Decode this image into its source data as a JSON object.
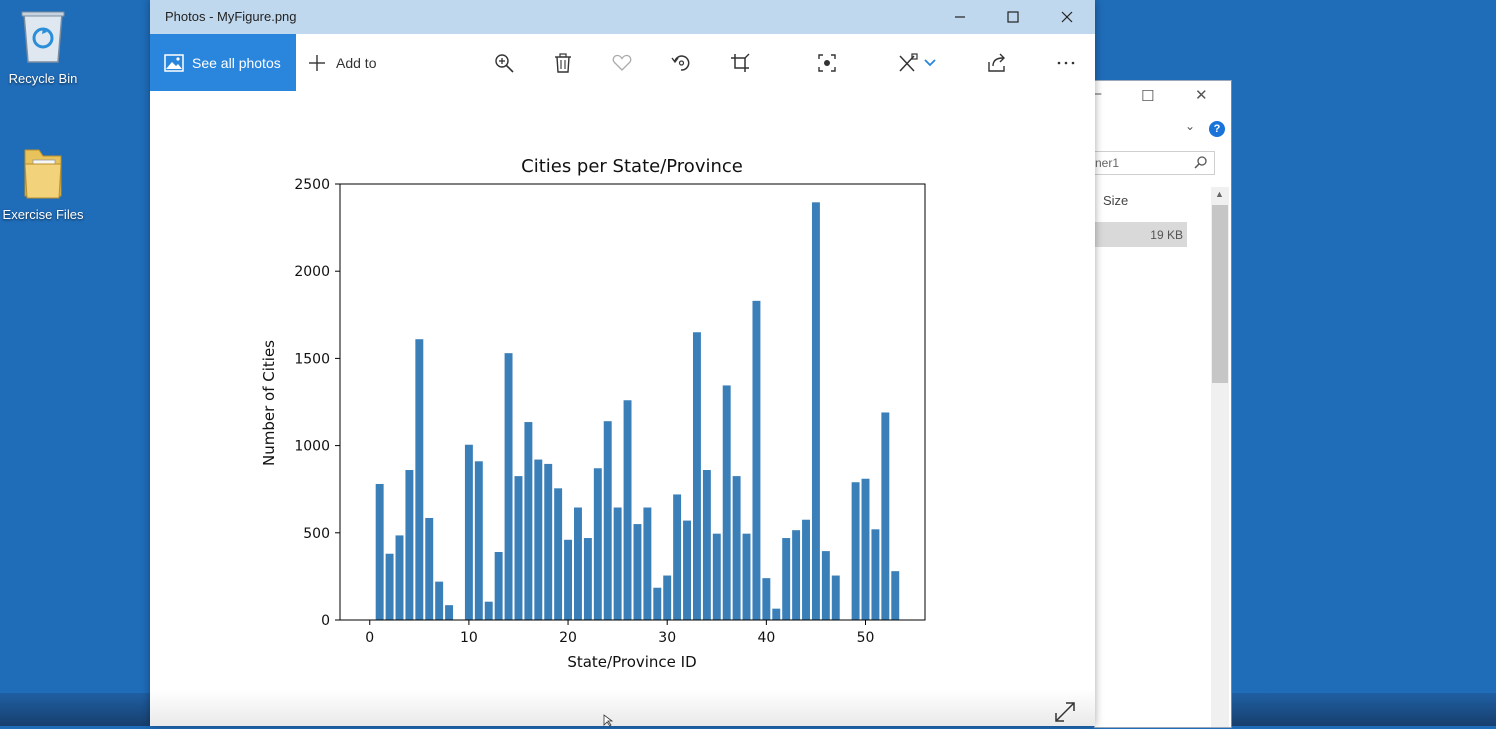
{
  "desktop": {
    "icons": [
      {
        "label": "Recycle Bin"
      },
      {
        "label": "Exercise Files"
      }
    ]
  },
  "explorer": {
    "search_placeholder": "ner1",
    "column_size": "Size",
    "row_size": "19 KB"
  },
  "photos": {
    "window_title": "Photos - MyFigure.png",
    "toolbar": {
      "see_all_label": "See all photos",
      "add_to_label": "Add to"
    }
  },
  "chart_data": {
    "type": "bar",
    "title": "Cities per State/Province",
    "xlabel": "State/Province ID",
    "ylabel": "Number of Cities",
    "xlim": [
      -3,
      56
    ],
    "ylim": [
      0,
      2500
    ],
    "xticks": [
      0,
      10,
      20,
      30,
      40,
      50
    ],
    "yticks": [
      0,
      500,
      1000,
      1500,
      2000,
      2500
    ],
    "grid": false,
    "color": "#3a7fb8",
    "x": [
      1,
      2,
      3,
      4,
      5,
      6,
      7,
      8,
      10,
      11,
      12,
      13,
      14,
      15,
      16,
      17,
      18,
      19,
      20,
      21,
      22,
      23,
      24,
      25,
      26,
      27,
      28,
      29,
      30,
      31,
      32,
      33,
      34,
      35,
      36,
      37,
      38,
      39,
      40,
      41,
      42,
      43,
      44,
      45,
      46,
      47,
      49,
      50,
      51,
      52,
      53
    ],
    "values": [
      780,
      380,
      485,
      860,
      1610,
      585,
      220,
      85,
      1005,
      910,
      105,
      390,
      1530,
      825,
      1135,
      920,
      895,
      755,
      460,
      645,
      470,
      870,
      1140,
      645,
      1260,
      550,
      645,
      185,
      255,
      720,
      570,
      1650,
      860,
      495,
      1345,
      825,
      495,
      1830,
      240,
      65,
      470,
      515,
      575,
      2395,
      395,
      255,
      790,
      810,
      520,
      1190,
      280
    ]
  }
}
